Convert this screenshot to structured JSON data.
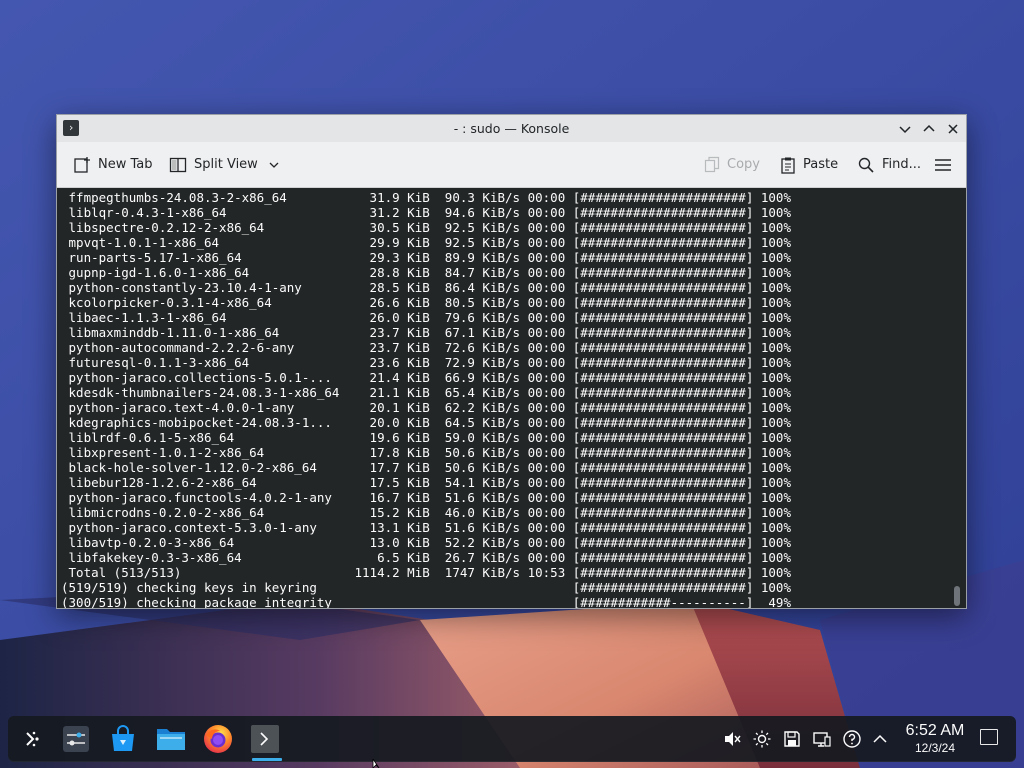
{
  "window": {
    "title": "- : sudo — Konsole"
  },
  "toolbar": {
    "new_tab": "New Tab",
    "split_view": "Split View",
    "copy": "Copy",
    "paste": "Paste",
    "find": "Find..."
  },
  "terminal": {
    "lines": [
      " ffmpegthumbs-24.08.3-2-x86_64           31.9 KiB  90.3 KiB/s 00:00 [######################] 100%",
      " liblqr-0.4.3-1-x86_64                   31.2 KiB  94.6 KiB/s 00:00 [######################] 100%",
      " libspectre-0.2.12-2-x86_64              30.5 KiB  92.5 KiB/s 00:00 [######################] 100%",
      " mpvqt-1.0.1-1-x86_64                    29.9 KiB  92.5 KiB/s 00:00 [######################] 100%",
      " run-parts-5.17-1-x86_64                 29.3 KiB  89.9 KiB/s 00:00 [######################] 100%",
      " gupnp-igd-1.6.0-1-x86_64                28.8 KiB  84.7 KiB/s 00:00 [######################] 100%",
      " python-constantly-23.10.4-1-any         28.5 KiB  86.4 KiB/s 00:00 [######################] 100%",
      " kcolorpicker-0.3.1-4-x86_64             26.6 KiB  80.5 KiB/s 00:00 [######################] 100%",
      " libaec-1.1.3-1-x86_64                   26.0 KiB  79.6 KiB/s 00:00 [######################] 100%",
      " libmaxminddb-1.11.0-1-x86_64            23.7 KiB  67.1 KiB/s 00:00 [######################] 100%",
      " python-autocommand-2.2.2-6-any          23.7 KiB  72.6 KiB/s 00:00 [######################] 100%",
      " futuresql-0.1.1-3-x86_64                23.6 KiB  72.9 KiB/s 00:00 [######################] 100%",
      " python-jaraco.collections-5.0.1-...     21.4 KiB  66.9 KiB/s 00:00 [######################] 100%",
      " kdesdk-thumbnailers-24.08.3-1-x86_64    21.1 KiB  65.4 KiB/s 00:00 [######################] 100%",
      " python-jaraco.text-4.0.0-1-any          20.1 KiB  62.2 KiB/s 00:00 [######################] 100%",
      " kdegraphics-mobipocket-24.08.3-1...     20.0 KiB  64.5 KiB/s 00:00 [######################] 100%",
      " liblrdf-0.6.1-5-x86_64                  19.6 KiB  59.0 KiB/s 00:00 [######################] 100%",
      " libxpresent-1.0.1-2-x86_64              17.8 KiB  50.6 KiB/s 00:00 [######################] 100%",
      " black-hole-solver-1.12.0-2-x86_64       17.7 KiB  50.6 KiB/s 00:00 [######################] 100%",
      " libebur128-1.2.6-2-x86_64               17.5 KiB  54.1 KiB/s 00:00 [######################] 100%",
      " python-jaraco.functools-4.0.2-1-any     16.7 KiB  51.6 KiB/s 00:00 [######################] 100%",
      " libmicrodns-0.2.0-2-x86_64              15.2 KiB  46.0 KiB/s 00:00 [######################] 100%",
      " python-jaraco.context-5.3.0-1-any       13.1 KiB  51.6 KiB/s 00:00 [######################] 100%",
      " libavtp-0.2.0-3-x86_64                  13.0 KiB  52.2 KiB/s 00:00 [######################] 100%",
      " libfakekey-0.3-3-x86_64                  6.5 KiB  26.7 KiB/s 00:00 [######################] 100%",
      " Total (513/513)                       1114.2 MiB  1747 KiB/s 10:53 [######################] 100%",
      "(519/519) checking keys in keyring                                  [######################] 100%",
      "(300/519) checking package integrity                                [############----------]  49%"
    ]
  },
  "taskbar": {
    "apps": [
      {
        "name": "application-launcher",
        "icon": "kde-launcher-icon"
      },
      {
        "name": "system-settings",
        "icon": "settings-sliders-icon"
      },
      {
        "name": "discover",
        "icon": "store-bag-icon"
      },
      {
        "name": "dolphin",
        "icon": "folder-icon"
      },
      {
        "name": "firefox",
        "icon": "firefox-icon"
      },
      {
        "name": "konsole",
        "icon": "terminal-icon"
      }
    ],
    "tray": [
      "volume-muted-icon",
      "brightness-icon",
      "storage-icon",
      "network-icon",
      "help-icon",
      "expand-arrow-icon"
    ],
    "time": "6:52 AM",
    "date": "12/3/24"
  }
}
